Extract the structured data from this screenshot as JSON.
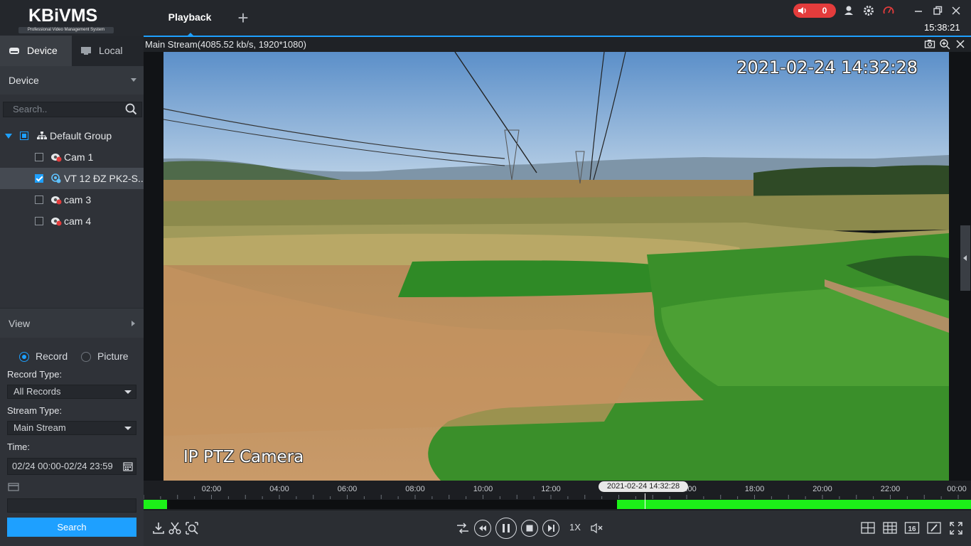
{
  "app": {
    "logo_text": "KBiVMS",
    "logo_subtitle": "Professional Video Management System",
    "active_tab": "Playback",
    "alarm_count": "0",
    "clock": "15:38:21"
  },
  "sidebar": {
    "tabs": [
      {
        "label": "Device",
        "icon": "device-icon",
        "active": true
      },
      {
        "label": "Local",
        "icon": "monitor-icon",
        "active": false
      }
    ],
    "device_header": "Device",
    "search_placeholder": "Search..",
    "tree": {
      "group": "Default Group",
      "cameras": [
        {
          "label": "Cam 1",
          "checked": false,
          "selected": false
        },
        {
          "label": "VT 12 ĐZ PK2-S...",
          "checked": true,
          "selected": true
        },
        {
          "label": "cam 3",
          "checked": false,
          "selected": false
        },
        {
          "label": "cam 4",
          "checked": false,
          "selected": false
        }
      ]
    },
    "view_header": "View",
    "mode": {
      "record": "Record",
      "picture": "Picture",
      "selected": "record"
    },
    "record_type_label": "Record Type:",
    "record_type_value": "All Records",
    "stream_type_label": "Stream Type:",
    "stream_type_value": "Main Stream",
    "time_label": "Time:",
    "time_value": "02/24 00:00-02/24 23:59",
    "search_button": "Search"
  },
  "viewer": {
    "stream_info": "Main Stream(4085.52 kb/s, 1920*1080)",
    "osd_timestamp": "2021-02-24 14:32:28",
    "osd_camera_name": "IP PTZ Camera"
  },
  "timeline": {
    "hour_labels": [
      "02:00",
      "04:00",
      "06:00",
      "08:00",
      "10:00",
      "12:00",
      "16:00",
      "18:00",
      "20:00",
      "22:00",
      "00:00"
    ],
    "cursor_time": "2021-02-24 14:32:28",
    "recorded_segments_hours": [
      [
        0,
        0.7
      ],
      [
        14.0,
        24
      ]
    ]
  },
  "controls": {
    "speed": "1X"
  },
  "colors": {
    "accent": "#1ea0ff",
    "record_green": "#1cf018",
    "alarm_red": "#e43c3c"
  }
}
